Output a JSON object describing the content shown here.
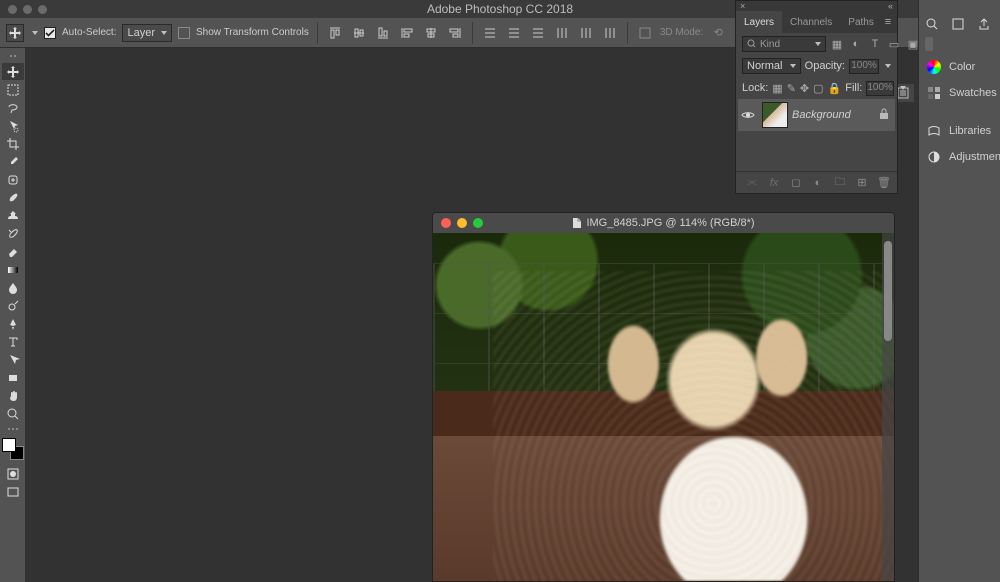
{
  "app": {
    "title": "Adobe Photoshop CC 2018"
  },
  "options": {
    "autoSelectLabel": "Auto-Select:",
    "autoSelectChecked": true,
    "autoSelectTarget": "Layer",
    "showTransformLabel": "Show Transform Controls",
    "showTransformChecked": false,
    "threeDModeLabel": "3D Mode:"
  },
  "document": {
    "title": "IMG_8485.JPG @ 114% (RGB/8*)"
  },
  "layersPanel": {
    "tabs": [
      "Layers",
      "Channels",
      "Paths"
    ],
    "activeTab": 0,
    "filterKind": "Kind",
    "blendMode": "Normal",
    "opacityLabel": "Opacity:",
    "opacityValue": "100%",
    "lockLabel": "Lock:",
    "fillLabel": "Fill:",
    "fillValue": "100%",
    "layer": {
      "name": "Background",
      "visible": true,
      "locked": true
    }
  },
  "rightPanels": [
    "Color",
    "Swatches",
    "Libraries",
    "Adjustments"
  ],
  "tools": [
    "move-tool",
    "rect-marquee-tool",
    "lasso-tool",
    "quick-select-tool",
    "crop-tool",
    "eyedropper-tool",
    "healing-brush-tool",
    "brush-tool",
    "clone-stamp-tool",
    "history-brush-tool",
    "eraser-tool",
    "gradient-tool",
    "blur-tool",
    "dodge-tool",
    "pen-tool",
    "type-tool",
    "path-select-tool",
    "rectangle-tool",
    "hand-tool",
    "zoom-tool"
  ]
}
